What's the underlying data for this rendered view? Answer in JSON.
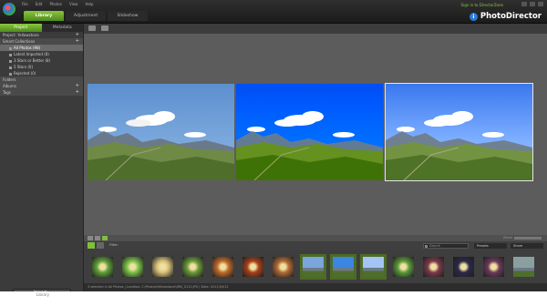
{
  "app": {
    "brand": "PhotoDirector",
    "brand_icon_glyph": "i",
    "signin_link": "Sign in to DirectorZone",
    "menu": [
      "File",
      "Edit",
      "Photos",
      "View",
      "Help"
    ],
    "tabs": [
      "Library",
      "Adjustment",
      "Slideshow"
    ]
  },
  "left_panel": {
    "tabs": [
      "Project",
      "Metadata"
    ],
    "project_label": "Project: Yellowstone",
    "smart_collections": "Smart Collections",
    "collection_items": [
      "All Photos (98)",
      "Latest Imported (8)",
      "3 Stars or Better (8)",
      "5 Stars (0)",
      "Rejected (0)"
    ],
    "sections": [
      "Folders",
      "Albums",
      "Tags"
    ],
    "plus": "+",
    "import_button": "Import..."
  },
  "film_toolbar": {
    "sort_label": "Filter:",
    "search_placeholder": "Search",
    "presets_label": "Presets",
    "share_label": "Share"
  },
  "view_controls": {
    "zoom_label": "Zoom"
  },
  "status": {
    "text": "3 selected in All Photos   |   Location: C:\\Photos\\Yellowstone\\IMG_0112.JPG   |   Date: 2011/04/12"
  },
  "bottom": {
    "label": "Library"
  },
  "colors": {
    "accent_green": "#7fbf3c",
    "panel_dark": "#3b3b3b",
    "viewer_bg": "#5c5c5c",
    "brand_blue": "#2b7bd8"
  },
  "photos": [
    {
      "sky": "#8fb9e4",
      "sky_top": "#5d8fd0",
      "tint": "none"
    },
    {
      "sky": "#2f7fe0",
      "sky_top": "#0f4fb3",
      "tint": "saturated"
    },
    {
      "sky": "#a3c4f5",
      "sky_top": "#3d73d9",
      "tint": "cool"
    }
  ],
  "thumbnails": [
    {
      "color": "#5fa03a",
      "kind": "flower"
    },
    {
      "color": "#7cc24a",
      "kind": "flower"
    },
    {
      "color": "#d7c17a",
      "kind": "portrait"
    },
    {
      "color": "#6b9a3a",
      "kind": "leaf"
    },
    {
      "color": "#c06a2b",
      "kind": "food"
    },
    {
      "color": "#a8401a",
      "kind": "food"
    },
    {
      "color": "#b36a36",
      "kind": "food"
    },
    {
      "color": "#7aa6dc",
      "kind": "landscape"
    },
    {
      "color": "#3a86e0",
      "kind": "landscape"
    },
    {
      "color": "#a3c4f5",
      "kind": "landscape"
    },
    {
      "color": "#5a9a3a",
      "kind": "leaf"
    },
    {
      "color": "#7a3a4a",
      "kind": "portrait"
    },
    {
      "color": "#2a2a4a",
      "kind": "night"
    },
    {
      "color": "#6a3a5a",
      "kind": "portrait"
    },
    {
      "color": "#8aa0a0",
      "kind": "landscape"
    }
  ]
}
